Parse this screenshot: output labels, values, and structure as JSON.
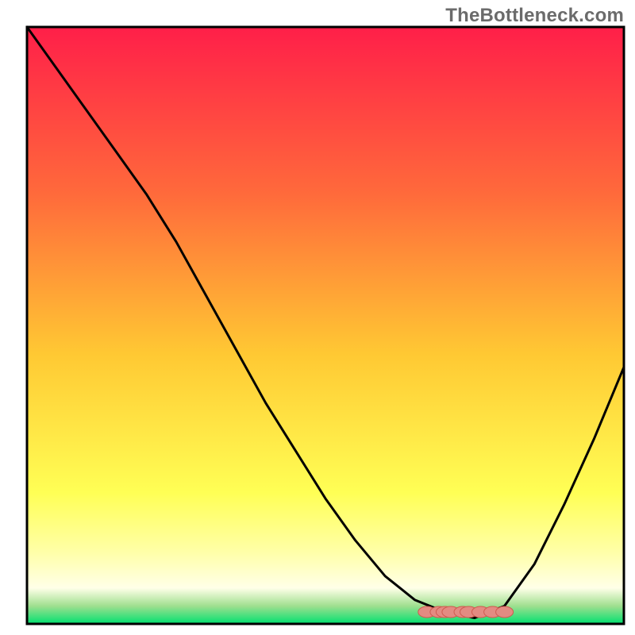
{
  "watermark": "TheBottleneck.com",
  "palette": {
    "grad_top": "#ff1f49",
    "grad_mid1": "#ff6a3b",
    "grad_mid2": "#ffc933",
    "grad_mid3": "#ffff55",
    "grad_mid4": "#ffffa8",
    "grad_mid5": "#ffffe8",
    "grad_near_bottom": "#9fdf8f",
    "grad_bottom": "#00e070",
    "line": "#000000",
    "marker_fill": "#e38b82",
    "marker_stroke": "#cf5a4f",
    "frame": "#000000"
  },
  "chart_data": {
    "type": "line",
    "title": "",
    "xlabel": "",
    "ylabel": "",
    "xlim": [
      0,
      100
    ],
    "ylim": [
      0,
      100
    ],
    "grid": false,
    "legend": false,
    "x": [
      0,
      5,
      10,
      15,
      20,
      25,
      30,
      35,
      40,
      45,
      50,
      55,
      60,
      65,
      70,
      75,
      80,
      85,
      90,
      95,
      100
    ],
    "series": [
      {
        "name": "curve",
        "values": [
          100,
          93,
          86,
          79,
          72,
          64,
          55,
          46,
          37,
          29,
          21,
          14,
          8,
          4,
          2,
          1,
          3,
          10,
          20,
          31,
          43
        ]
      }
    ],
    "markers": {
      "x": [
        67,
        69,
        70,
        71,
        73,
        74,
        76,
        78,
        80
      ],
      "y": [
        2,
        2,
        2,
        2,
        2,
        2,
        2,
        2,
        2
      ]
    }
  }
}
